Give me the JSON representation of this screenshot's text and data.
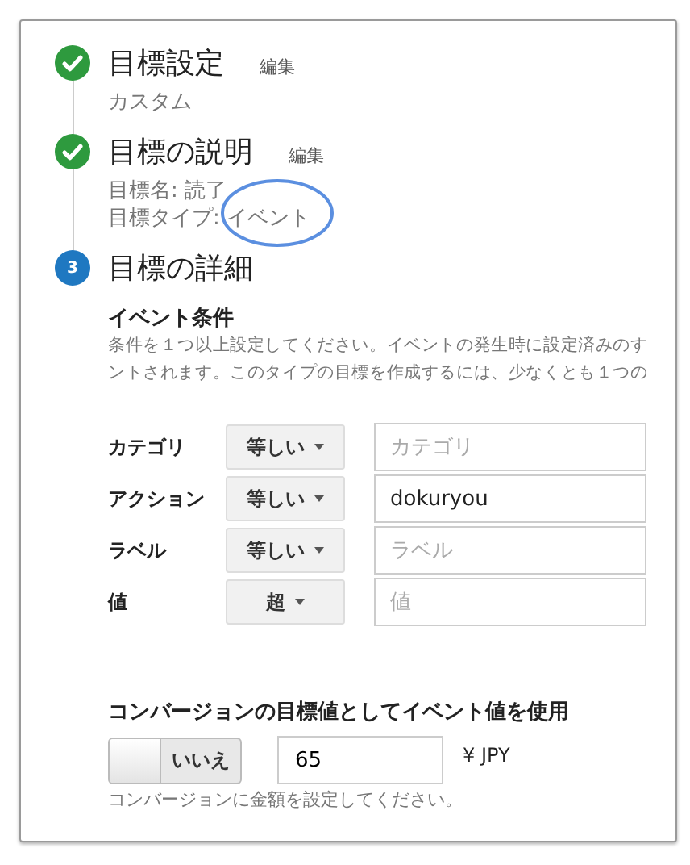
{
  "steps": [
    {
      "kind": "done",
      "title": "目標設定",
      "edit": "編集",
      "lines": [
        "カスタム"
      ]
    },
    {
      "kind": "done",
      "title": "目標の説明",
      "edit": "編集",
      "lines": [
        "目標名: 読了",
        "目標タイプ: イベント"
      ]
    },
    {
      "kind": "number",
      "number": "3",
      "title": "目標の詳細"
    }
  ],
  "conditions": {
    "heading": "イベント条件",
    "description": [
      "条件を１つ以上設定してください。イベントの発生時に設定済みのす",
      "ントされます。このタイプの目標を作成するには、少なくとも１つの"
    ],
    "rows": [
      {
        "label": "カテゴリ",
        "operator": "等しい",
        "placeholder": "カテゴリ"
      },
      {
        "label": "アクション",
        "operator": "等しい",
        "value": "dokuryou"
      },
      {
        "label": "ラベル",
        "operator": "等しい",
        "placeholder": "ラベル"
      },
      {
        "label": "値",
        "operator": "超",
        "placeholder": "値"
      }
    ]
  },
  "conversion": {
    "heading": "コンバージョンの目標値としてイベント値を使用",
    "toggle": {
      "on": false,
      "label": "いいえ"
    },
    "amount": "65",
    "currency": "¥ JPY",
    "help": "コンバージョンに金額を設定してください。"
  }
}
